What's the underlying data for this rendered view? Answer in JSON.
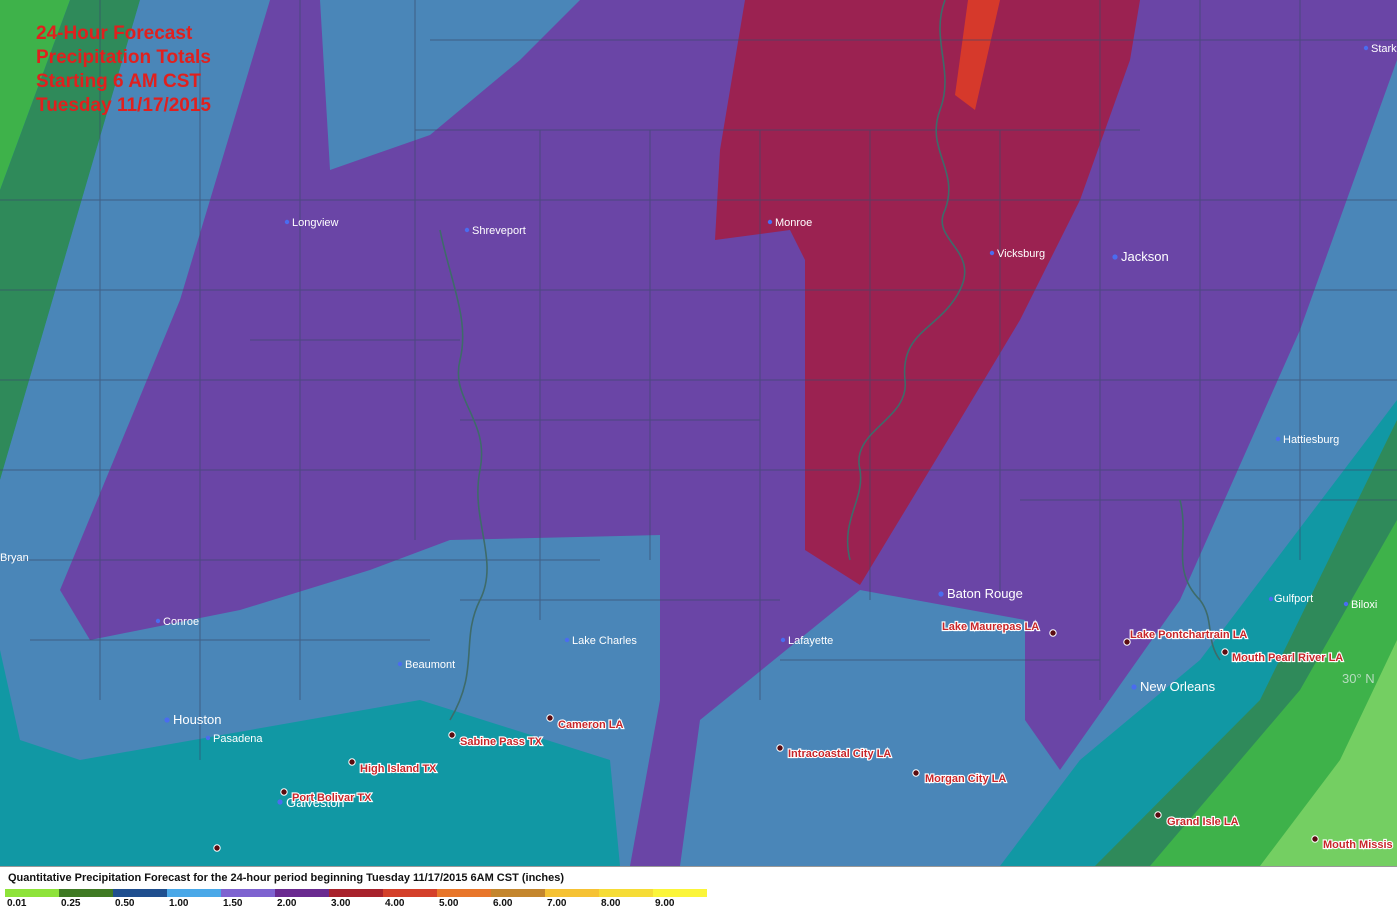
{
  "title": {
    "line1": "24-Hour Forecast",
    "line2": "Precipitation Totals",
    "line3": "Starting 6 AM CST",
    "line4": "Tuesday 11/17/2015"
  },
  "cities": [
    {
      "id": "longview",
      "name": "Longview"
    },
    {
      "id": "shreveport",
      "name": "Shreveport"
    },
    {
      "id": "monroe",
      "name": "Monroe"
    },
    {
      "id": "vicksburg",
      "name": "Vicksburg"
    },
    {
      "id": "jackson",
      "name": "Jackson"
    },
    {
      "id": "hattiesburg",
      "name": "Hattiesburg"
    },
    {
      "id": "bryan",
      "name": "Bryan"
    },
    {
      "id": "conroe",
      "name": "Conroe"
    },
    {
      "id": "beaumont",
      "name": "Beaumont"
    },
    {
      "id": "lake-charles",
      "name": "Lake Charles"
    },
    {
      "id": "lafayette",
      "name": "Lafayette"
    },
    {
      "id": "baton-rouge",
      "name": "Baton Rouge"
    },
    {
      "id": "houston",
      "name": "Houston"
    },
    {
      "id": "pasadena",
      "name": "Pasadena"
    },
    {
      "id": "galveston",
      "name": "Galveston"
    },
    {
      "id": "new-orleans",
      "name": "New Orleans"
    },
    {
      "id": "gulfport",
      "name": "Gulfport"
    },
    {
      "id": "biloxi",
      "name": "Biloxi"
    },
    {
      "id": "stark",
      "name": "Stark"
    }
  ],
  "stations": [
    {
      "id": "lake-maurepas",
      "name": "Lake Maurepas LA"
    },
    {
      "id": "lake-pontchartrain",
      "name": "Lake Pontchartrain LA"
    },
    {
      "id": "mouth-pearl-river",
      "name": "Mouth Pearl River LA"
    },
    {
      "id": "cameron",
      "name": "Cameron LA"
    },
    {
      "id": "sabine-pass",
      "name": "Sabine Pass TX"
    },
    {
      "id": "high-island",
      "name": "High Island TX"
    },
    {
      "id": "port-bolivar",
      "name": "Port Bolivar TX"
    },
    {
      "id": "intracoastal-city",
      "name": "Intracoastal City LA"
    },
    {
      "id": "morgan-city",
      "name": "Morgan City LA"
    },
    {
      "id": "grand-isle",
      "name": "Grand Isle LA"
    },
    {
      "id": "mouth-mississippi",
      "name": "Mouth Missis"
    }
  ],
  "grid_label": "30° N",
  "legend": {
    "title": "Quantitative Precipitation Forecast for the 24-hour period beginning Tuesday 11/17/2015 6AM CST (inches)",
    "bins": [
      {
        "label": "0.01",
        "color": "#8ee33a"
      },
      {
        "label": "0.25",
        "color": "#3f7a23"
      },
      {
        "label": "0.50",
        "color": "#1f4f8f"
      },
      {
        "label": "1.00",
        "color": "#4aa8e8"
      },
      {
        "label": "1.50",
        "color": "#7e63d0"
      },
      {
        "label": "2.00",
        "color": "#6a2a90"
      },
      {
        "label": "3.00",
        "color": "#a8222c"
      },
      {
        "label": "4.00",
        "color": "#d4402a"
      },
      {
        "label": "5.00",
        "color": "#e8762a"
      },
      {
        "label": "6.00",
        "color": "#c4862e"
      },
      {
        "label": "7.00",
        "color": "#f6c234"
      },
      {
        "label": "8.00",
        "color": "#f6dc36"
      },
      {
        "label": "9.00",
        "color": "#fbf53a"
      }
    ]
  },
  "colors": {
    "band_teal": "#1198a4",
    "band_blue": "#4a86b8",
    "band_purple": "#6a45a6",
    "band_maroon": "#9b2251",
    "band_red": "#d6392b",
    "band_green_dark": "#2f8a5a",
    "band_green": "#3eb24a",
    "band_green_light": "#74cf62",
    "border": "#3a4a6a",
    "river": "#3e6b6a",
    "title": "#e0201e"
  }
}
